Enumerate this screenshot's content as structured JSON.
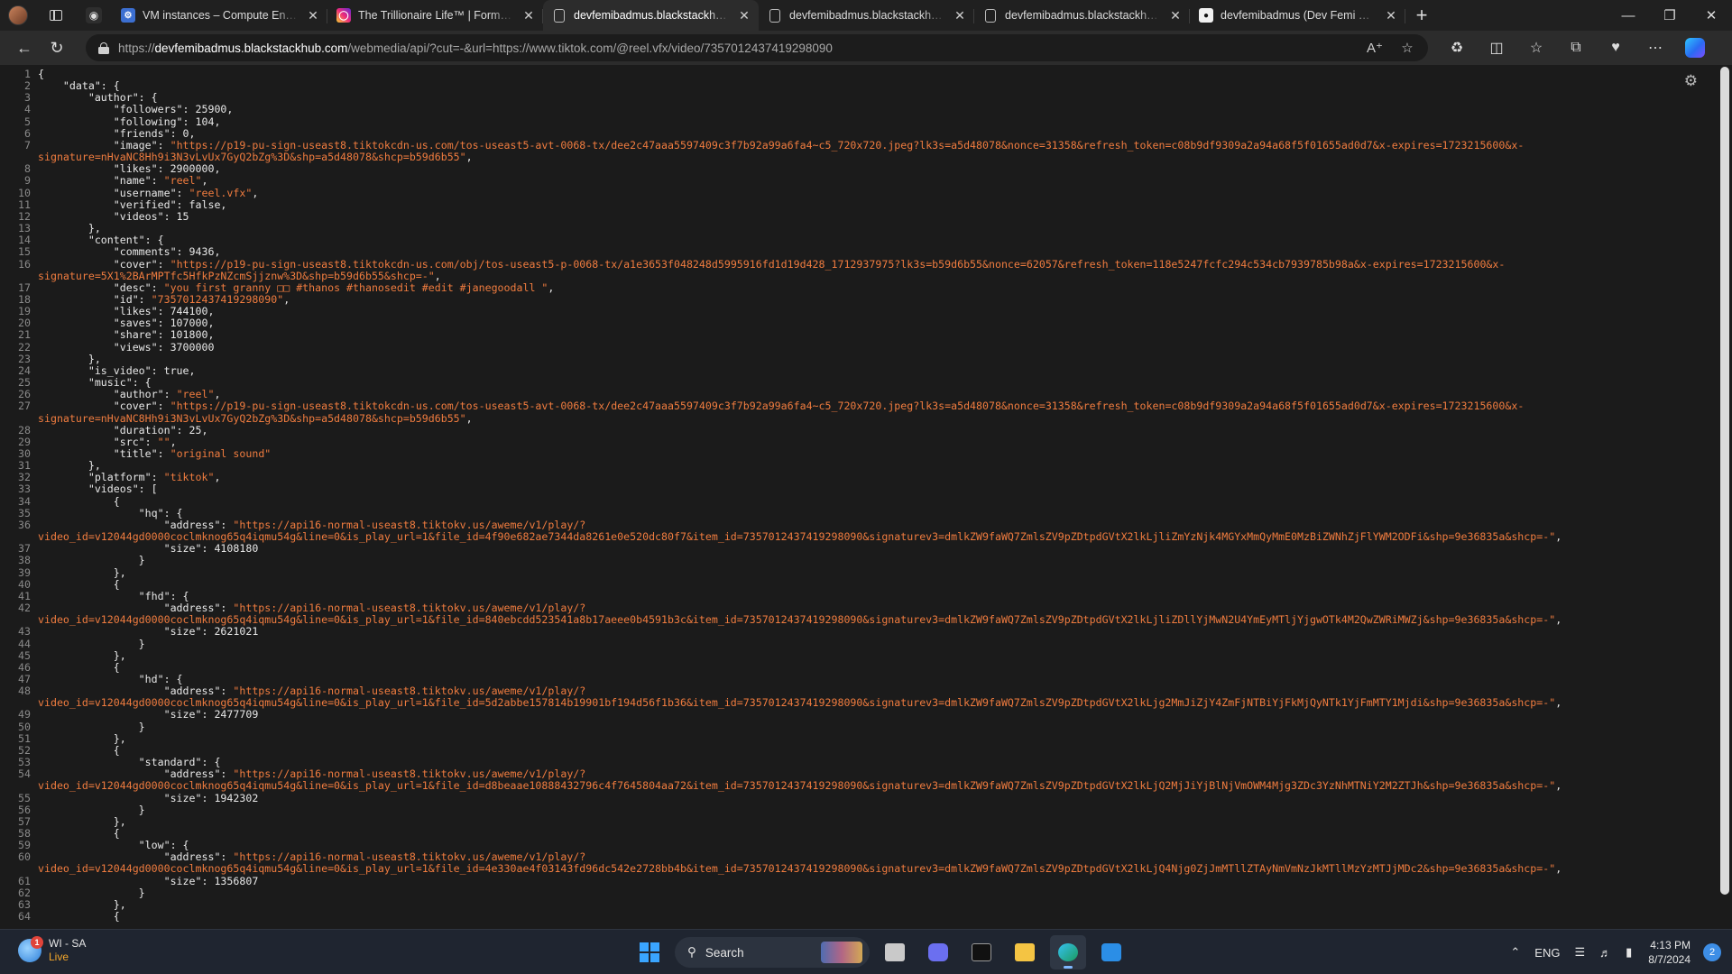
{
  "colors": {
    "json_string": "#f07c3f",
    "json_key": "#e8e8e8",
    "line_number": "#8a8a8a",
    "background": "#1b1b1b"
  },
  "tabs": [
    {
      "title": "VM instances – Compute Engine",
      "favicon": "google-cloud-icon"
    },
    {
      "title": "The Trillionaire Life™ | Former Pr",
      "favicon": "instagram-icon"
    },
    {
      "title": "devfemibadmus.blackstackhub.c",
      "favicon": "document-icon",
      "active": true
    },
    {
      "title": "devfemibadmus.blackstackhub.c",
      "favicon": "document-icon"
    },
    {
      "title": "devfemibadmus.blackstackhub.c",
      "favicon": "document-icon"
    },
    {
      "title": "devfemibadmus (Dev Femi Badm",
      "favicon": "github-icon"
    }
  ],
  "address_bar": {
    "protocol": "https://",
    "host": "devfemibadmus.blackstackhub.com",
    "path": "/webmedia/api/?cut=-&url=https://www.tiktok.com/@reel.vfx/video/7357012437419298090"
  },
  "code": {
    "lines": [
      {
        "n": "1",
        "t": "{"
      },
      {
        "n": "2",
        "t": "    \"data\": {"
      },
      {
        "n": "3",
        "t": "        \"author\": {"
      },
      {
        "n": "4",
        "t": "            \"followers\": 25900,"
      },
      {
        "n": "5",
        "t": "            \"following\": 104,"
      },
      {
        "n": "6",
        "t": "            \"friends\": 0,"
      },
      {
        "n": "7",
        "t": "            \"image\": ",
        "s": "\"https://p19-pu-sign-useast8.tiktokcdn-us.com/tos-useast5-avt-0068-tx/dee2c47aaa5597409c3f7b92a99a6fa4~c5_720x720.jpeg?lk3s=a5d48078&nonce=31358&refresh_token=c08b9df9309a2a94a68f5f01655ad0d7&x-expires=1723215600&x-"
      },
      {
        "n": "",
        "s": "signature=nHvaNC8Hh9i3N3vLvUx7GyQ2bZg%3D&shp=a5d48078&shcp=b59d6b55\"",
        "t2": ","
      },
      {
        "n": "8",
        "t": "            \"likes\": 2900000,"
      },
      {
        "n": "9",
        "t": "            \"name\": ",
        "s": "\"reel\"",
        "t2": ","
      },
      {
        "n": "10",
        "t": "            \"username\": ",
        "s": "\"reel.vfx\"",
        "t2": ","
      },
      {
        "n": "11",
        "t": "            \"verified\": false,"
      },
      {
        "n": "12",
        "t": "            \"videos\": 15"
      },
      {
        "n": "13",
        "t": "        },"
      },
      {
        "n": "14",
        "t": "        \"content\": {"
      },
      {
        "n": "15",
        "t": "            \"comments\": 9436,"
      },
      {
        "n": "16",
        "t": "            \"cover\": ",
        "s": "\"https://p19-pu-sign-useast8.tiktokcdn-us.com/obj/tos-useast5-p-0068-tx/a1e3653f048248d5995916fd1d19d428_1712937975?lk3s=b59d6b55&nonce=62057&refresh_token=118e5247fcfc294c534cb7939785b98a&x-expires=1723215600&x-"
      },
      {
        "n": "",
        "s": "signature=5X1%2BArMPTfc5HfkPzNZcmSjjznw%3D&shp=b59d6b55&shcp=-\"",
        "t2": ","
      },
      {
        "n": "17",
        "t": "            \"desc\": ",
        "s": "\"you first granny □□ #thanos #thanosedit #edit #janegoodall \"",
        "t2": ","
      },
      {
        "n": "18",
        "t": "            \"id\": ",
        "s": "\"7357012437419298090\"",
        "t2": ","
      },
      {
        "n": "19",
        "t": "            \"likes\": 744100,"
      },
      {
        "n": "20",
        "t": "            \"saves\": 107000,"
      },
      {
        "n": "21",
        "t": "            \"share\": 101800,"
      },
      {
        "n": "22",
        "t": "            \"views\": 3700000"
      },
      {
        "n": "23",
        "t": "        },"
      },
      {
        "n": "24",
        "t": "        \"is_video\": true,"
      },
      {
        "n": "25",
        "t": "        \"music\": {"
      },
      {
        "n": "26",
        "t": "            \"author\": ",
        "s": "\"reel\"",
        "t2": ","
      },
      {
        "n": "27",
        "t": "            \"cover\": ",
        "s": "\"https://p19-pu-sign-useast8.tiktokcdn-us.com/tos-useast5-avt-0068-tx/dee2c47aaa5597409c3f7b92a99a6fa4~c5_720x720.jpeg?lk3s=a5d48078&nonce=31358&refresh_token=c08b9df9309a2a94a68f5f01655ad0d7&x-expires=1723215600&x-"
      },
      {
        "n": "",
        "s": "signature=nHvaNC8Hh9i3N3vLvUx7GyQ2bZg%3D&shp=a5d48078&shcp=b59d6b55\"",
        "t2": ","
      },
      {
        "n": "28",
        "t": "            \"duration\": 25,"
      },
      {
        "n": "29",
        "t": "            \"src\": ",
        "s": "\"\"",
        "t2": ","
      },
      {
        "n": "30",
        "t": "            \"title\": ",
        "s": "\"original sound\""
      },
      {
        "n": "31",
        "t": "        },"
      },
      {
        "n": "32",
        "t": "        \"platform\": ",
        "s": "\"tiktok\"",
        "t2": ","
      },
      {
        "n": "33",
        "t": "        \"videos\": ["
      },
      {
        "n": "34",
        "t": "            {"
      },
      {
        "n": "35",
        "t": "                \"hq\": {"
      },
      {
        "n": "36",
        "t": "                    \"address\": ",
        "s": "\"https://api16-normal-useast8.tiktokv.us/aweme/v1/play/?"
      },
      {
        "n": "",
        "s": "video_id=v12044gd0000coclmknog65q4iqmu54g&line=0&is_play_url=1&file_id=4f90e682ae7344da8261e0e520dc80f7&item_id=7357012437419298090&signaturev3=dmlkZW9faWQ7ZmlsZV9pZDtpdGVtX2lkLjliZmYzNjk4MGYxMmQyMmE0MzBiZWNhZjFlYWM2ODFi&shp=9e36835a&shcp=-\"",
        "t2": ","
      },
      {
        "n": "37",
        "t": "                    \"size\": 4108180"
      },
      {
        "n": "38",
        "t": "                }"
      },
      {
        "n": "39",
        "t": "            },"
      },
      {
        "n": "40",
        "t": "            {"
      },
      {
        "n": "41",
        "t": "                \"fhd\": {"
      },
      {
        "n": "42",
        "t": "                    \"address\": ",
        "s": "\"https://api16-normal-useast8.tiktokv.us/aweme/v1/play/?"
      },
      {
        "n": "",
        "s": "video_id=v12044gd0000coclmknog65q4iqmu54g&line=0&is_play_url=1&file_id=840ebcdd523541a8b17aeee0b4591b3c&item_id=7357012437419298090&signaturev3=dmlkZW9faWQ7ZmlsZV9pZDtpdGVtX2lkLjliZDllYjMwN2U4YmEyMTljYjgwOTk4M2QwZWRiMWZj&shp=9e36835a&shcp=-\"",
        "t2": ","
      },
      {
        "n": "43",
        "t": "                    \"size\": 2621021"
      },
      {
        "n": "44",
        "t": "                }"
      },
      {
        "n": "45",
        "t": "            },"
      },
      {
        "n": "46",
        "t": "            {"
      },
      {
        "n": "47",
        "t": "                \"hd\": {"
      },
      {
        "n": "48",
        "t": "                    \"address\": ",
        "s": "\"https://api16-normal-useast8.tiktokv.us/aweme/v1/play/?"
      },
      {
        "n": "",
        "s": "video_id=v12044gd0000coclmknog65q4iqmu54g&line=0&is_play_url=1&file_id=5d2abbe157814b19901bf194d56f1b36&item_id=7357012437419298090&signaturev3=dmlkZW9faWQ7ZmlsZV9pZDtpdGVtX2lkLjg2MmJiZjY4ZmFjNTBiYjFkMjQyNTk1YjFmMTY1Mjdi&shp=9e36835a&shcp=-\"",
        "t2": ","
      },
      {
        "n": "49",
        "t": "                    \"size\": 2477709"
      },
      {
        "n": "50",
        "t": "                }"
      },
      {
        "n": "51",
        "t": "            },"
      },
      {
        "n": "52",
        "t": "            {"
      },
      {
        "n": "53",
        "t": "                \"standard\": {"
      },
      {
        "n": "54",
        "t": "                    \"address\": ",
        "s": "\"https://api16-normal-useast8.tiktokv.us/aweme/v1/play/?"
      },
      {
        "n": "",
        "s": "video_id=v12044gd0000coclmknog65q4iqmu54g&line=0&is_play_url=1&file_id=d8beaae10888432796c4f7645804aa72&item_id=7357012437419298090&signaturev3=dmlkZW9faWQ7ZmlsZV9pZDtpdGVtX2lkLjQ2MjJiYjBlNjVmOWM4Mjg3ZDc3YzNhMTNiY2M2ZTJh&shp=9e36835a&shcp=-\"",
        "t2": ","
      },
      {
        "n": "55",
        "t": "                    \"size\": 1942302"
      },
      {
        "n": "56",
        "t": "                }"
      },
      {
        "n": "57",
        "t": "            },"
      },
      {
        "n": "58",
        "t": "            {"
      },
      {
        "n": "59",
        "t": "                \"low\": {"
      },
      {
        "n": "60",
        "t": "                    \"address\": ",
        "s": "\"https://api16-normal-useast8.tiktokv.us/aweme/v1/play/?"
      },
      {
        "n": "",
        "s": "video_id=v12044gd0000coclmknog65q4iqmu54g&line=0&is_play_url=1&file_id=4e330ae4f03143fd96dc542e2728bb4b&item_id=7357012437419298090&signaturev3=dmlkZW9faWQ7ZmlsZV9pZDtpdGVtX2lkLjQ4Njg0ZjJmMTllZTAyNmVmNzJkMTllMzYzMTJjMDc2&shp=9e36835a&shcp=-\"",
        "t2": ","
      },
      {
        "n": "61",
        "t": "                    \"size\": 1356807"
      },
      {
        "n": "62",
        "t": "                }"
      },
      {
        "n": "63",
        "t": "            },"
      },
      {
        "n": "64",
        "t": "            {"
      }
    ]
  },
  "taskbar": {
    "weather_title": "WI - SA",
    "weather_sub": "Live",
    "weather_badge": "1",
    "search_label": "Search",
    "language": "ENG",
    "time": "4:13 PM",
    "date": "8/7/2024",
    "notifications": "2"
  }
}
